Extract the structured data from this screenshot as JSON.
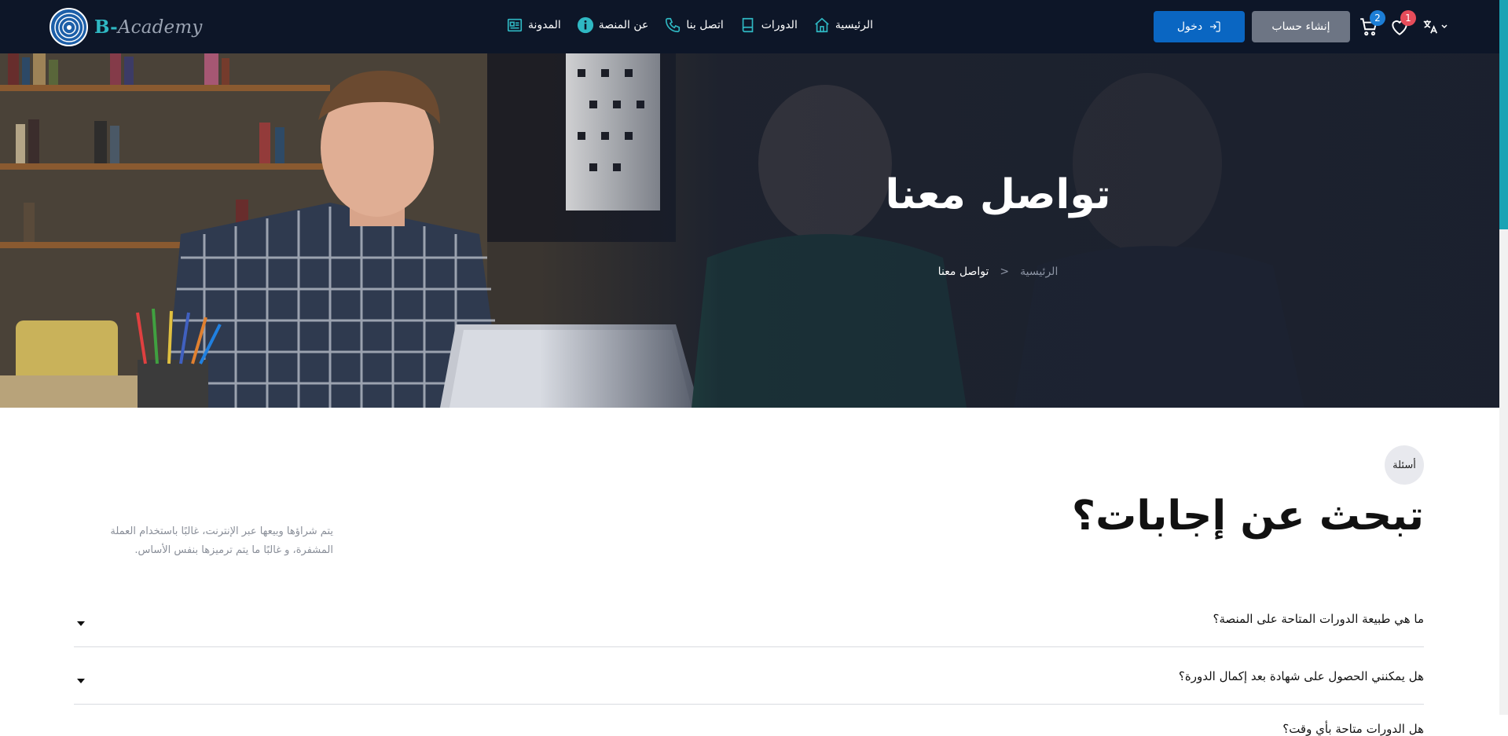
{
  "colors": {
    "navbar_bg": "#0d1628",
    "login_button": "#0a66c2",
    "register_button": "#6d7584",
    "accent_teal": "#2fb8c3",
    "badge_cart": "#1c7ed6",
    "badge_wishlist": "#e64c5a"
  },
  "brand": {
    "prefix": "B-",
    "name": "Academy"
  },
  "nav": {
    "items": [
      {
        "label": "المدونة",
        "icon": "blog-icon"
      },
      {
        "label": "عن المنصة",
        "icon": "info-icon"
      },
      {
        "label": "اتصل بنا",
        "icon": "phone-icon"
      },
      {
        "label": "الدورات",
        "icon": "book-icon"
      },
      {
        "label": "الرئيسية",
        "icon": "home-icon"
      }
    ]
  },
  "actions": {
    "login_label": "دخول",
    "register_label": "إنشاء حساب",
    "cart_count": "2",
    "wishlist_count": "1",
    "language_icon": "translate-icon"
  },
  "hero": {
    "title": "تواصل معنا",
    "breadcrumb": {
      "home": "الرئيسية",
      "separator": "<",
      "current": "تواصل معنا"
    }
  },
  "faq": {
    "tag": "أسئلة",
    "title": "تبحث عن إجابات؟",
    "description": "يتم شراؤها وبيعها عبر الإنترنت، غالبًا باستخدام العملة المشفرة، و غالبًا ما يتم ترميزها بنفس الأساس.",
    "questions": [
      "ما هي طبيعة الدورات المتاحة على المنصة؟",
      "هل يمكنني الحصول على شهادة بعد إكمال الدورة؟",
      "هل الدورات متاحة بأي وقت؟"
    ]
  }
}
